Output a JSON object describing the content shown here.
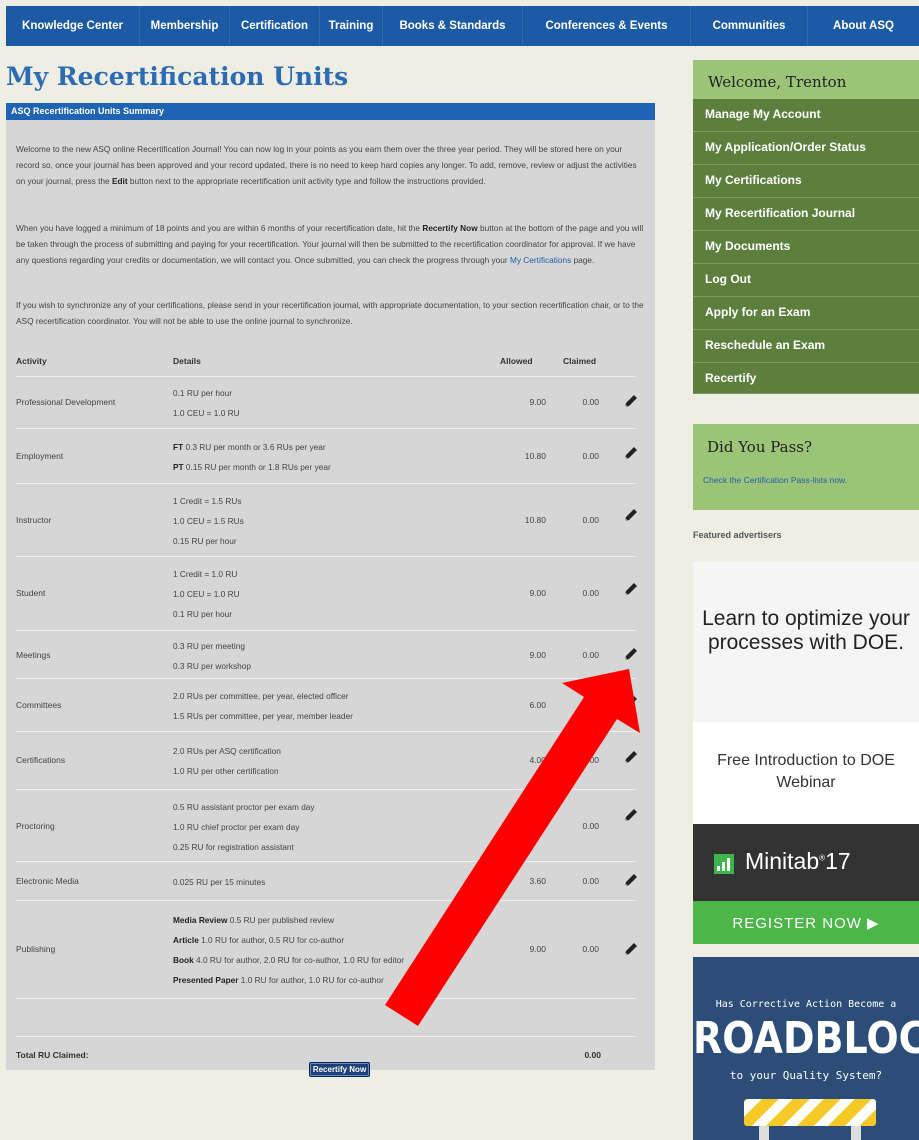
{
  "nav": [
    "Knowledge Center",
    "Membership",
    "Certification",
    "Training",
    "Books & Standards",
    "Conferences & Events",
    "Communities",
    "About ASQ"
  ],
  "page_title": "My Recertification Units",
  "summary_header": "ASQ Recertification Units Summary",
  "intro": {
    "p1a": "Welcome to the new ASQ online Recertification Journal! You can now log in your points as you earn them over the three year period. They will be stored here on your record so, once your journal has been approved and your record updated, there is no need to keep hard copies any longer. To add, remove, review or adjust the activities on your journal, press the ",
    "p1b": "Edit",
    "p1c": " button next to the appropriate recertification unit activity type and follow the instructions provided.",
    "p2a": "When you have logged a minimum of 18 points and you are within 6 months of your recertification date, hit the ",
    "p2b": "Recertify Now",
    "p2c": " button at the bottom of the page and you will be taken through the process of submitting and paying for your recertification. Your journal will then be submitted to the recertification coordinator for approval. If we have any questions regarding your credits or documentation, we will contact you. Once submitted, you can check the progress through your ",
    "p2link": "My Certifications",
    "p2d": " page.",
    "p3": "If you wish to synchronize any of your certifications, please send in your recertification journal, with appropriate documentation, to your section recertification chair, or to the ASQ recertification coordinator. You will not be able to use the online journal to synchronize."
  },
  "table": {
    "headers": {
      "activity": "Activity",
      "details": "Details",
      "allowed": "Allowed",
      "claimed": "Claimed"
    },
    "rows": [
      {
        "activity": "Professional Development",
        "details": [
          {
            "b": "",
            "t": "0.1 RU per hour"
          },
          {
            "b": "",
            "t": "1.0 CEU = 1.0 RU"
          }
        ],
        "allowed": "9.00",
        "claimed": "0.00"
      },
      {
        "activity": "Employment",
        "details": [
          {
            "b": "FT",
            "t": " 0.3 RU per month or 3.6 RUs per year"
          },
          {
            "b": "PT",
            "t": " 0.15 RU per month or 1.8 RUs per year"
          }
        ],
        "allowed": "10.80",
        "claimed": "0.00"
      },
      {
        "activity": "Instructor",
        "details": [
          {
            "b": "",
            "t": "1 Credit = 1.5 RUs"
          },
          {
            "b": "",
            "t": "1.0 CEU = 1.5 RUs"
          },
          {
            "b": "",
            "t": "0.15 RU per hour"
          }
        ],
        "allowed": "10.80",
        "claimed": "0.00"
      },
      {
        "activity": "Student",
        "details": [
          {
            "b": "",
            "t": "1 Credit = 1.0 RU"
          },
          {
            "b": "",
            "t": "1.0 CEU = 1.0 RU"
          },
          {
            "b": "",
            "t": "0.1 RU per hour"
          }
        ],
        "allowed": "9.00",
        "claimed": "0.00"
      },
      {
        "activity": "Meetings",
        "details": [
          {
            "b": "",
            "t": "0.3 RU per meeting"
          },
          {
            "b": "",
            "t": "0.3 RU per workshop"
          }
        ],
        "allowed": "9.00",
        "claimed": "0.00"
      },
      {
        "activity": "Committees",
        "details": [
          {
            "b": "",
            "t": "2.0 RUs per committee, per year, elected officer"
          },
          {
            "b": "",
            "t": "1.5 RUs per committee, per year, member leader"
          }
        ],
        "allowed": "6.00",
        "claimed": ""
      },
      {
        "activity": "Certifications",
        "details": [
          {
            "b": "",
            "t": "2.0 RUs per ASQ certification"
          },
          {
            "b": "",
            "t": "1.0 RU per other certification"
          }
        ],
        "allowed": "4.00",
        "claimed": "0.00"
      },
      {
        "activity": "Proctoring",
        "details": [
          {
            "b": "",
            "t": "0.5 RU assistant proctor per exam day"
          },
          {
            "b": "",
            "t": "1.0 RU chief proctor per exam day"
          },
          {
            "b": "",
            "t": "0.25 RU for registration assistant"
          }
        ],
        "allowed": "",
        "claimed": "0.00"
      },
      {
        "activity": "Electronic Media",
        "details": [
          {
            "b": "",
            "t": "0.025 RU per 15 minutes"
          }
        ],
        "allowed": "3.60",
        "claimed": "0.00"
      },
      {
        "activity": "Publishing",
        "details": [
          {
            "b": "Media Review",
            "t": " 0.5 RU per published review"
          },
          {
            "b": "Article",
            "t": " 1.0 RU for author, 0.5 RU for co-author"
          },
          {
            "b": "Book",
            "t": " 4.0 RU for author, 2.0 RU for co-author, 1.0 RU for editor"
          },
          {
            "b": "Presented Paper",
            "t": " 1.0 RU for author, 1.0 RU for co-author"
          }
        ],
        "allowed": "9.00",
        "claimed": "0.00"
      }
    ],
    "total_label": "Total RU Claimed:",
    "total_value": "0.00"
  },
  "recertify_button": "Recertify Now",
  "sidebar": {
    "welcome": "Welcome, Trenton",
    "menu": [
      "Manage My Account",
      "My Application/Order Status",
      "My Certifications",
      "My Recertification Journal",
      "My Documents",
      "Log Out",
      "Apply for an Exam",
      "Reschedule an Exam",
      "Recertify"
    ],
    "pass_title": "Did You Pass?",
    "pass_link": "Check the Certification Pass-lists now.",
    "featured": "Featured advertisers",
    "ad1_headline": "Learn to optimize your processes with DOE.",
    "ad1_sub": "Free Introduction to DOE Webinar",
    "ad1_brand": "Minitab",
    "ad1_brand_version": "17",
    "ad1_cta": "REGISTER NOW ▶",
    "ad2_line1": "Has Corrective Action Become a",
    "ad2_big": "ROADBLOCK",
    "ad2_line3": "to your Quality System?"
  },
  "colors": {
    "nav": "#1d5aa6",
    "sidebar_menu": "#5d7f3e",
    "sidebar_header": "#9bc477",
    "arrow": "#ff0000"
  },
  "icons": {
    "edit": "pencil-icon",
    "annotation": "red-arrow"
  }
}
